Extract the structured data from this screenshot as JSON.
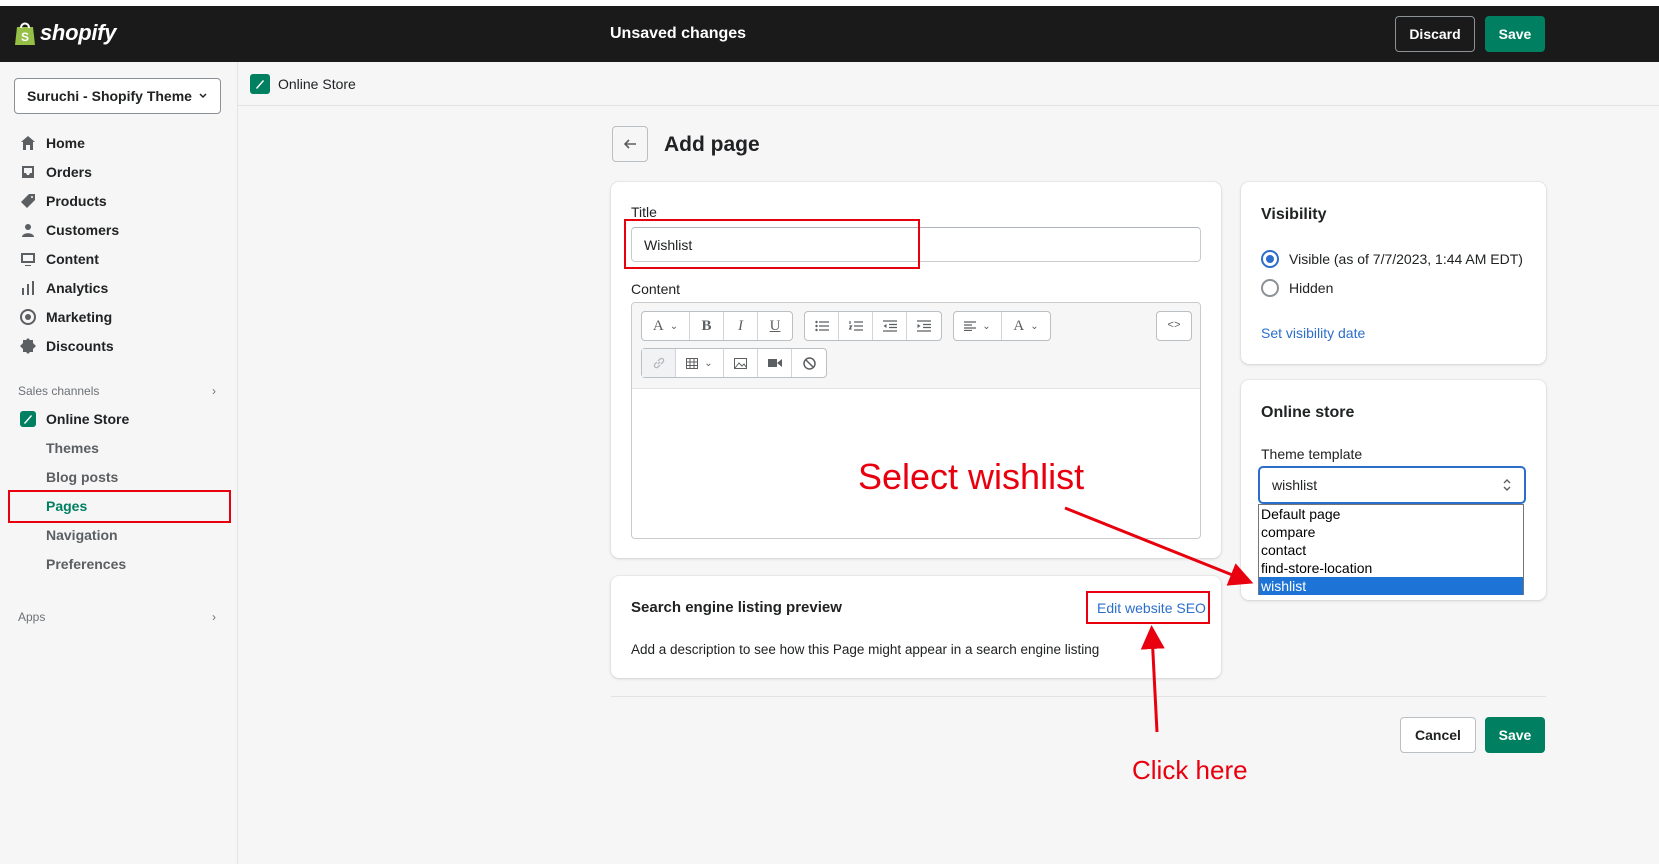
{
  "topbar": {
    "logo_text": "shopify",
    "title": "Unsaved changes",
    "discard_label": "Discard",
    "save_label": "Save"
  },
  "sidebar": {
    "store_name": "Suruchi - Shopify Theme",
    "items": [
      {
        "label": "Home",
        "icon": "home-icon"
      },
      {
        "label": "Orders",
        "icon": "orders-icon"
      },
      {
        "label": "Products",
        "icon": "tag-icon"
      },
      {
        "label": "Customers",
        "icon": "person-icon"
      },
      {
        "label": "Content",
        "icon": "content-icon"
      },
      {
        "label": "Analytics",
        "icon": "analytics-icon"
      },
      {
        "label": "Marketing",
        "icon": "marketing-icon"
      },
      {
        "label": "Discounts",
        "icon": "discount-icon"
      }
    ],
    "sales_channels_label": "Sales channels",
    "online_store_label": "Online Store",
    "sub_items": [
      "Themes",
      "Blog posts",
      "Pages",
      "Navigation",
      "Preferences"
    ],
    "active_sub_item": "Pages",
    "apps_label": "Apps"
  },
  "breadcrumb": {
    "label": "Online Store"
  },
  "page": {
    "heading": "Add page"
  },
  "form": {
    "title_label": "Title",
    "title_value": "Wishlist",
    "content_label": "Content"
  },
  "seo": {
    "title": "Search engine listing preview",
    "edit_link": "Edit website SEO",
    "description": "Add a description to see how this Page might appear in a search engine listing"
  },
  "visibility": {
    "title": "Visibility",
    "visible_label": "Visible (as of 7/7/2023, 1:44 AM EDT)",
    "hidden_label": "Hidden",
    "set_date_link": "Set visibility date",
    "selected": "visible"
  },
  "online_store": {
    "title": "Online store",
    "template_label": "Theme template",
    "selected_value": "wishlist",
    "options": [
      "Default page",
      "compare",
      "contact",
      "find-store-location",
      "wishlist"
    ]
  },
  "footer": {
    "cancel_label": "Cancel",
    "save_label": "Save"
  },
  "annotations": {
    "select_text": "Select wishlist",
    "click_text": "Click here",
    "color": "#e8000e"
  },
  "colors": {
    "brand_green": "#008060",
    "link_blue": "#2c6ecb",
    "topbar_bg": "#1a1a1a"
  }
}
